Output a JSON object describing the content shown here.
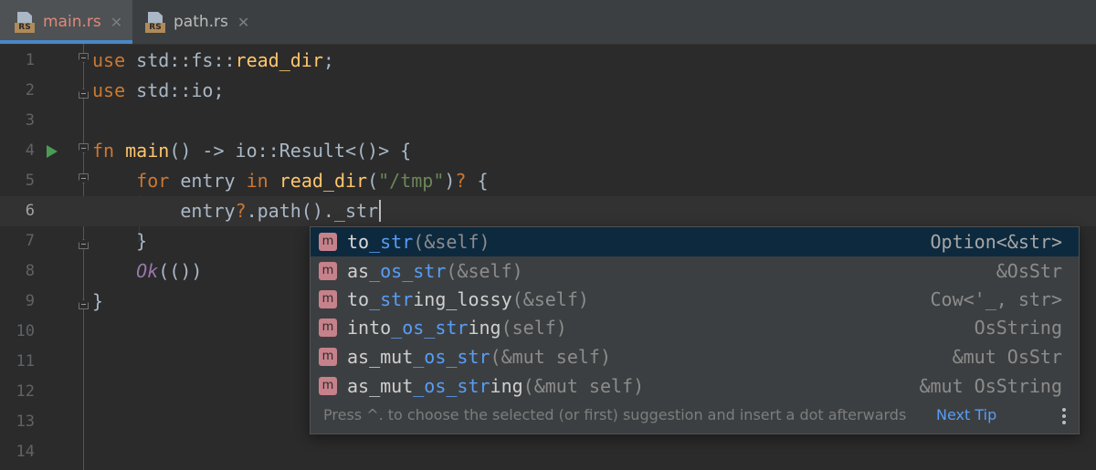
{
  "tabs": [
    {
      "label": "main.rs",
      "icon": "rust-file-icon",
      "badge": "RS",
      "active": true
    },
    {
      "label": "path.rs",
      "icon": "rust-file-icon",
      "badge": "RS",
      "active": false
    }
  ],
  "editor": {
    "line_numbers": [
      "1",
      "2",
      "3",
      "4",
      "5",
      "6",
      "7",
      "8",
      "9",
      "10",
      "11",
      "12",
      "13",
      "14"
    ],
    "current_line": "6"
  },
  "completion": {
    "items": [
      {
        "prefix": "to",
        "match": "_str",
        "rest": "",
        "params": "(&self)",
        "type": "Option<&str>"
      },
      {
        "prefix": "as",
        "match": "_os_str",
        "rest": "",
        "params": "(&self)",
        "type": "&OsStr"
      },
      {
        "prefix": "to",
        "match": "_str",
        "rest": "ing_lossy",
        "params": "(&self)",
        "type": "Cow<'_, str>"
      },
      {
        "prefix": "into",
        "match": "_os_str",
        "rest": "ing",
        "params": "(self)",
        "type": "OsString"
      },
      {
        "prefix": "as_mut",
        "match": "_os_str",
        "rest": "",
        "params": "(&mut self)",
        "type": "&mut OsStr"
      },
      {
        "prefix": "as_mut",
        "match": "_os_str",
        "rest": "ing",
        "params": "(&mut self)",
        "type": "&mut OsString"
      }
    ],
    "badge": "m",
    "hint": "Press ^. to choose the selected (or first) suggestion and insert a dot afterwards",
    "next_tip": "Next Tip"
  },
  "colors": {
    "background": "#2b2b2b",
    "keyword": "#cc7832",
    "function": "#ffc66d",
    "string": "#6a8759",
    "match_highlight": "#589df6",
    "selection": "#0d293e",
    "method_badge": "#c6818a"
  }
}
